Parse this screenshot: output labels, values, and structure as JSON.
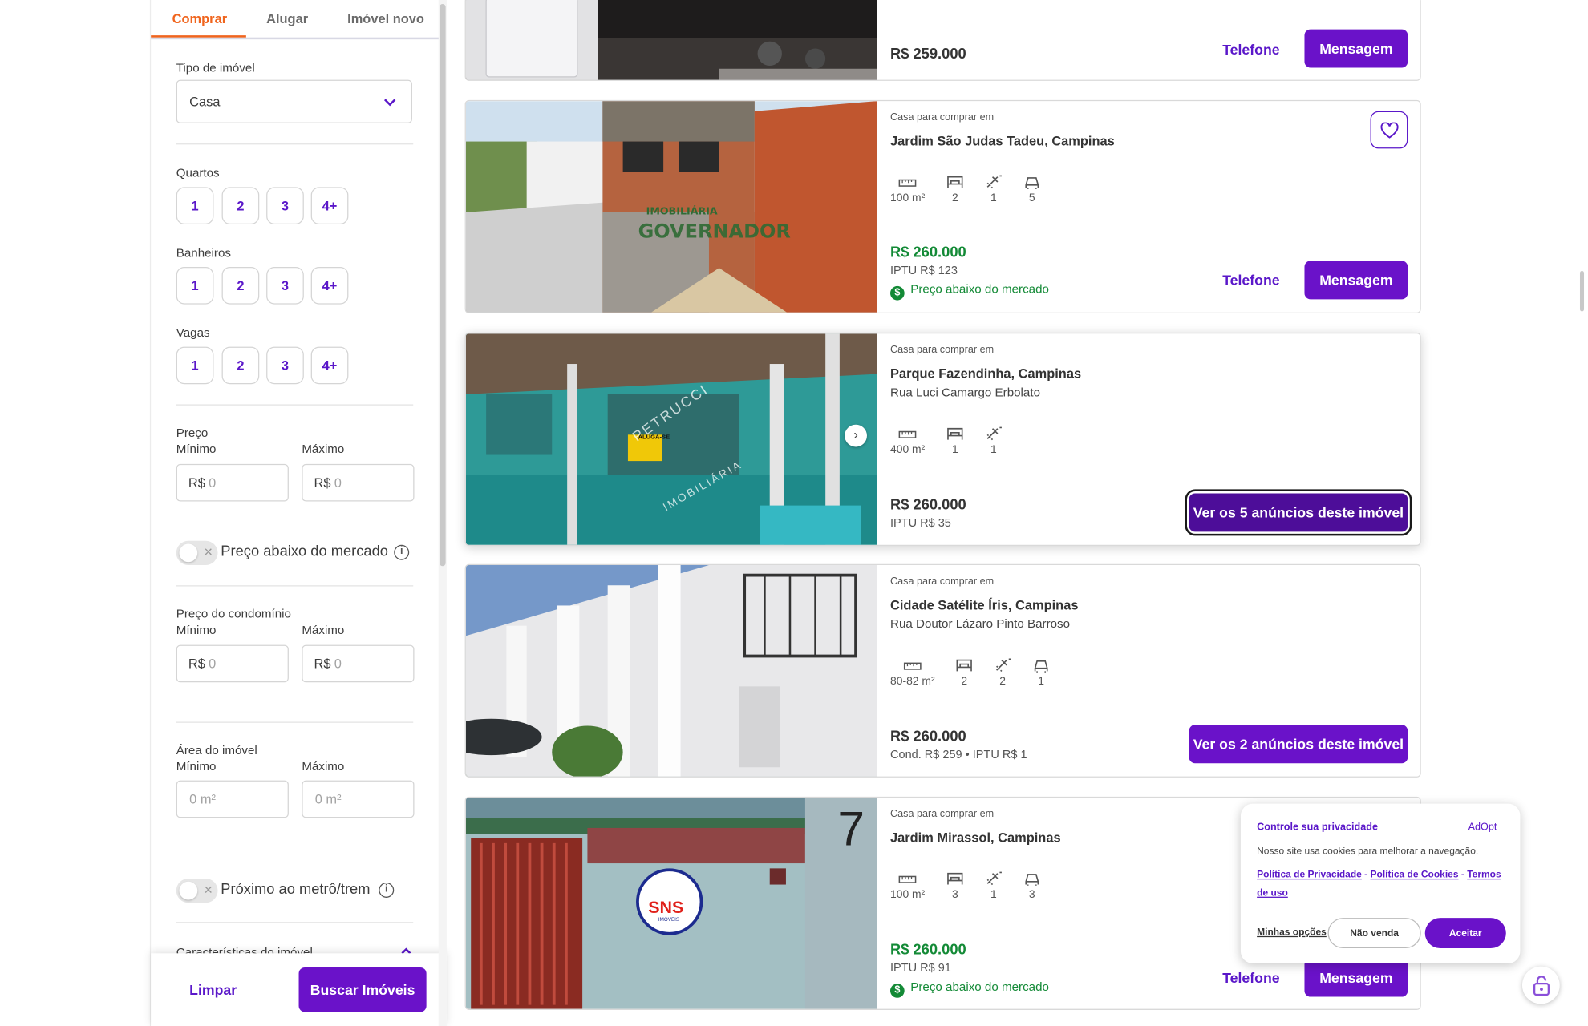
{
  "tabs": [
    {
      "label": "Comprar",
      "active": true
    },
    {
      "label": "Alugar",
      "active": false
    },
    {
      "label": "Imóvel novo",
      "active": false
    }
  ],
  "filters": {
    "property_type": {
      "label": "Tipo de imóvel",
      "value": "Casa"
    },
    "bedrooms": {
      "label": "Quartos",
      "options": [
        "1",
        "2",
        "3",
        "4+"
      ]
    },
    "bathrooms": {
      "label": "Banheiros",
      "options": [
        "1",
        "2",
        "3",
        "4+"
      ]
    },
    "parking": {
      "label": "Vagas",
      "options": [
        "1",
        "2",
        "3",
        "4+"
      ]
    },
    "price": {
      "label": "Preço",
      "min_label": "Mínimo",
      "max_label": "Máximo",
      "currency": "R$",
      "min_placeholder": "0",
      "max_placeholder": "0"
    },
    "below_market_toggle": {
      "label": "Preço abaixo do mercado",
      "on": false
    },
    "condo": {
      "label": "Preço do condomínio",
      "min_label": "Mínimo",
      "max_label": "Máximo",
      "currency": "R$",
      "min_placeholder": "0",
      "max_placeholder": "0"
    },
    "area": {
      "label": "Área do imóvel",
      "min_label": "Mínimo",
      "max_label": "Máximo",
      "min_placeholder": "0 m²",
      "max_placeholder": "0 m²"
    },
    "metro_toggle": {
      "label": "Próximo ao metrô/trem",
      "on": false
    },
    "features_section": "Características do imóvel",
    "clear_label": "Limpar",
    "search_label": "Buscar Imóveis"
  },
  "listings": [
    {
      "price": "R$ 259.000",
      "phone_label": "Telefone",
      "message_label": "Mensagem"
    },
    {
      "kind": "Casa para comprar em",
      "title": "Jardim São Judas Tadeu, Campinas",
      "area": "100 m²",
      "bedrooms": "2",
      "bathrooms": "1",
      "parking": "5",
      "price": "R$ 260.000",
      "sub": "IPTU R$ 123",
      "badge": "Preço abaixo do mercado",
      "badge_symbol": "$",
      "photo_watermark": [
        "IMOBILIÁRIA",
        "GOVERNADOR"
      ],
      "phone_label": "Telefone",
      "message_label": "Mensagem"
    },
    {
      "kind": "Casa para comprar em",
      "title": "Parque Fazendinha, Campinas",
      "street": "Rua Luci Camargo Erbolato",
      "area": "400 m²",
      "bedrooms": "1",
      "bathrooms": "1",
      "price": "R$ 260.000",
      "sub": "IPTU R$ 35",
      "photo_watermark": [
        "PETRUCCI",
        "IMOBILIÁRIA"
      ],
      "photo_sign": "ALUGA-SE",
      "ads_label": "Ver os 5 anúncios deste imóvel"
    },
    {
      "kind": "Casa para comprar em",
      "title": "Cidade Satélite Íris, Campinas",
      "street": "Rua Doutor Lázaro Pinto Barroso",
      "area": "80-82 m²",
      "bedrooms": "2",
      "bathrooms": "2",
      "parking": "1",
      "price": "R$ 260.000",
      "sub": "Cond. R$ 259 • IPTU R$ 1",
      "ads_label": "Ver os 2 anúncios deste imóvel"
    },
    {
      "kind": "Casa para comprar em",
      "title": "Jardim Mirassol, Campinas",
      "area": "100 m²",
      "bedrooms": "3",
      "bathrooms": "1",
      "parking": "3",
      "price": "R$ 260.000",
      "sub": "IPTU R$ 91",
      "badge": "Preço abaixo do mercado",
      "badge_symbol": "$",
      "photo_logo": [
        "SNS",
        "IMÓVEIS"
      ],
      "photo_number": "7",
      "phone_label": "Telefone",
      "message_label": "Mensagem"
    }
  ],
  "cookie": {
    "title": "Controle sua privacidade",
    "brand": "AdOpt",
    "text": "Nosso site usa cookies para melhorar a navegação.",
    "link1": "Política de Privacidade",
    "sep": "-",
    "link2": "Política de Cookies",
    "link3": "Termos de uso",
    "options_label": "Minhas opções",
    "decline_label": "Não venda",
    "accept_label": "Aceitar"
  },
  "colors": {
    "accent": "#6a12c9",
    "tab_active": "#f0651e",
    "success": "#138a36"
  }
}
